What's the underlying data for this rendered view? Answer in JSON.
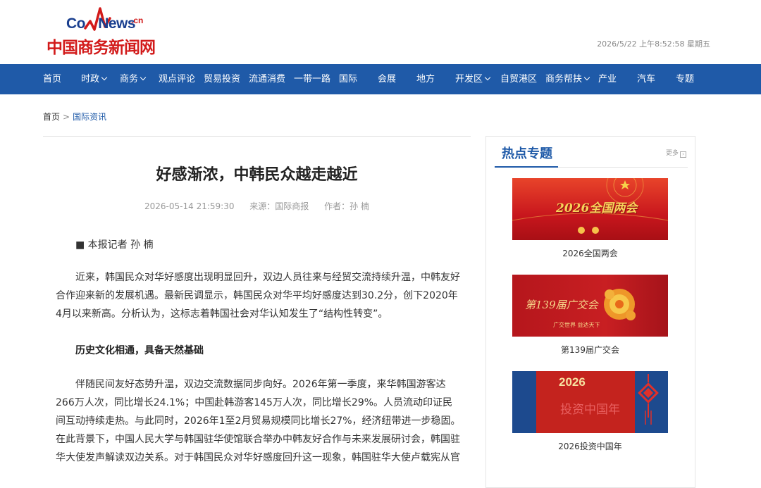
{
  "header": {
    "logo_en_prefix": "Co",
    "logo_en_mid": "m",
    "logo_en_suffix": "News",
    "logo_en_tld": ".cn",
    "logo_cn": "中国商务新闻网",
    "datetime": "2026/5/22 上午8:52:58 星期五"
  },
  "nav": {
    "items": [
      {
        "label": "首页",
        "dropdown": false
      },
      {
        "label": "时政",
        "dropdown": true
      },
      {
        "label": "商务",
        "dropdown": true
      },
      {
        "label": "观点评论",
        "dropdown": false
      },
      {
        "label": "贸易投资",
        "dropdown": false
      },
      {
        "label": "流通消费",
        "dropdown": false
      },
      {
        "label": "一带一路",
        "dropdown": false
      },
      {
        "label": "国际",
        "dropdown": false
      },
      {
        "label": "会展",
        "dropdown": false
      },
      {
        "label": "地方",
        "dropdown": false
      },
      {
        "label": "开发区",
        "dropdown": true
      },
      {
        "label": "自贸港区",
        "dropdown": false
      },
      {
        "label": "商务帮扶",
        "dropdown": true
      },
      {
        "label": "产业",
        "dropdown": false
      },
      {
        "label": "汽车",
        "dropdown": false
      },
      {
        "label": "专题",
        "dropdown": false
      }
    ]
  },
  "breadcrumb": {
    "home": "首页",
    "sep": ">",
    "current": "国际资讯"
  },
  "article": {
    "title": "好感渐浓，中韩民众越走越近",
    "date": "2026-05-14 21:59:30",
    "source": "来源：国际商报",
    "author": "作者：孙 楠",
    "reporter": "■ 本报记者 孙 楠",
    "para1": "近来，韩国民众对华好感度出现明显回升，双边人员往来与经贸交流持续升温，中韩友好合作迎来新的发展机遇。最新民调显示，韩国民众对华平均好感度达到30.2分，创下2020年4月以来新高。分析认为，这标志着韩国社会对华认知发生了“结构性转变”。",
    "subheading": "历史文化相通，具备天然基础",
    "para2": "伴随民间友好态势升温，双边交流数据同步向好。2026年第一季度，来华韩国游客达266万人次，同比增长24.1%；中国赴韩游客145万人次，同比增长29%。人员流动印证民间互动持续走热。与此同时，2026年1至2月贸易规模同比增长27%，经济纽带进一步稳固。在此背景下，中国人民大学与韩国驻华使馆联合举办中韩友好合作与未来发展研讨会，韩国驻华大使发声解读双边关系。对于韩国民众对华好感度回升这一现象，韩国驻华大使卢载宪从官方视角作出解读。卢载"
  },
  "sidebar": {
    "title": "热点专题",
    "more": "更多",
    "topics": [
      {
        "caption": "2026全国两会",
        "img_text": "2026全国两会"
      },
      {
        "caption": "第139届广交会",
        "img_text": "第139届广交会",
        "img_sub": "广交世界 益达天下"
      },
      {
        "caption": "2026投资中国年",
        "img_text": "投资中国年",
        "img_year": "2026"
      }
    ]
  },
  "colors": {
    "nav_bg": "#1f5aa8",
    "accent_red": "#d21a1a",
    "link_blue": "#1f5aa8"
  }
}
